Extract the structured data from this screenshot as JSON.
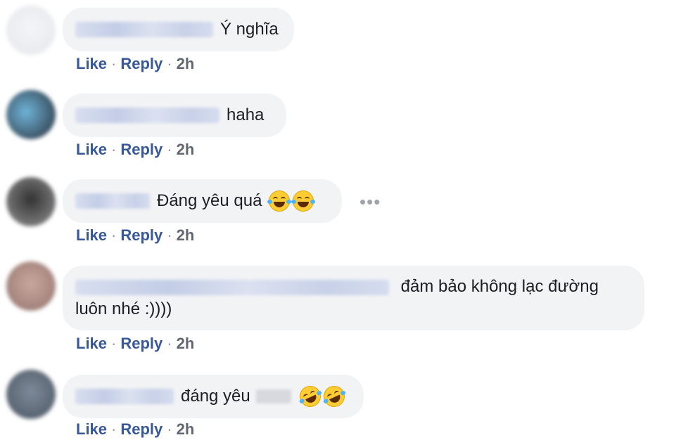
{
  "comments": [
    {
      "text": "Ý nghĩa",
      "actions": {
        "like": "Like",
        "reply": "Reply",
        "sep": "·",
        "time": "2h"
      }
    },
    {
      "text": "haha",
      "actions": {
        "like": "Like",
        "reply": "Reply",
        "sep": "·",
        "time": "2h"
      }
    },
    {
      "text": "Đáng yêu quá",
      "emojis": [
        "grinning-sweat-icon",
        "grinning-sweat-icon"
      ],
      "more": "•••",
      "actions": {
        "like": "Like",
        "reply": "Reply",
        "sep": "·",
        "time": "2h"
      }
    },
    {
      "text": "đảm bảo không lạc đường luôn nhé :))))",
      "actions": {
        "like": "Like",
        "reply": "Reply",
        "sep": "·",
        "time": "2h"
      }
    },
    {
      "text": "đáng yêu",
      "emojis": [
        "rofl-icon",
        "rofl-icon"
      ],
      "actions": {
        "like": "Like",
        "reply": "Reply",
        "sep": "·",
        "time": "2h"
      }
    }
  ],
  "colors": {
    "link": "#385898",
    "bubble": "#f2f3f5",
    "text": "#1c1e21",
    "timestamp": "#616770"
  }
}
